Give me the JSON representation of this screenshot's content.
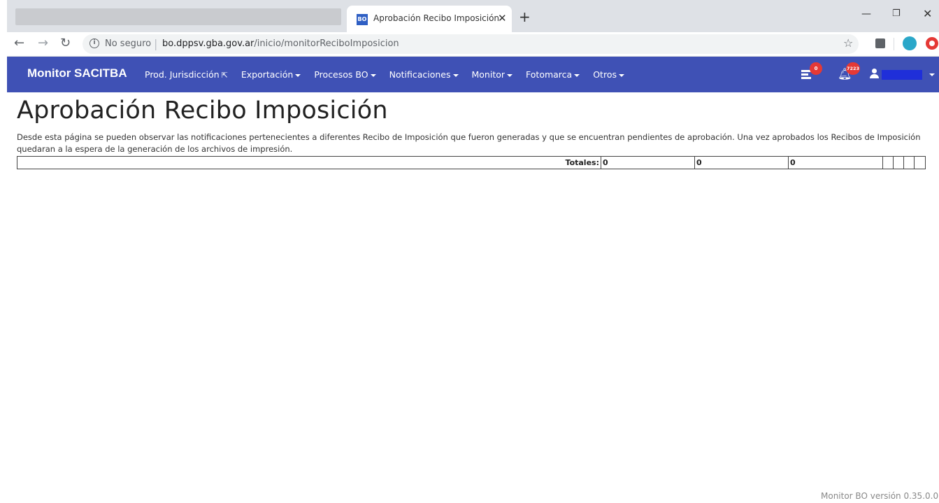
{
  "browser": {
    "tab": {
      "favicon": "BO",
      "title": "Aprobación Recibo Imposición"
    },
    "url": {
      "security": "No seguro",
      "host": "bo.dppsv.gba.gov.ar",
      "path": "/inicio/monitorReciboImposicion"
    }
  },
  "navbar": {
    "brand": "Monitor SACITBA",
    "items": [
      {
        "label": "Prod. Jurisdicción",
        "icon": "external-link-icon"
      },
      {
        "label": "Exportación",
        "icon": "caret-down"
      },
      {
        "label": "Procesos BO",
        "icon": "caret-down"
      },
      {
        "label": "Notificaciones",
        "icon": "caret-down"
      },
      {
        "label": "Monitor",
        "icon": "caret-down"
      },
      {
        "label": "Fotomarca",
        "icon": "caret-down"
      },
      {
        "label": "Otros",
        "icon": "caret-down"
      }
    ],
    "tasks_badge": "0",
    "alerts_badge": "7223",
    "accent": "#3f51b5"
  },
  "page": {
    "title": "Aprobación Recibo Imposición",
    "description": "Desde esta página se pueden observar las notificaciones pertenecientes a diferentes Recibo de Imposición que fueron generadas y que se encuentran pendientes de aprobación. Una vez aprobados los Recibos de Imposición quedaran a la espera de la generación de los archivos de impresión.",
    "totals": {
      "label": "Totales:",
      "values": [
        "0",
        "0",
        "0"
      ]
    }
  },
  "footer": {
    "version": "Monitor BO versión 0.35.0.0"
  }
}
